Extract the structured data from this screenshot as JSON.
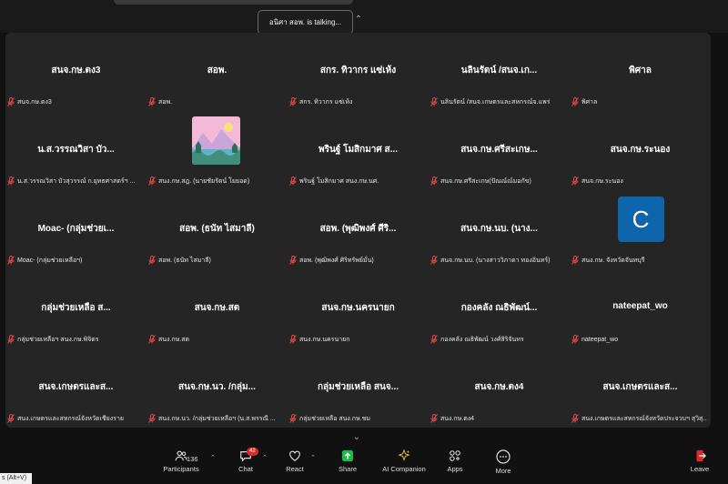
{
  "talking_indicator": "อนิศา สอพ. is talking...",
  "tiles": [
    {
      "big": "สนจ.กษ.ตง3",
      "name": "สนจ.กษ.ตง3"
    },
    {
      "big": "สอพ.",
      "name": "สอพ."
    },
    {
      "big": "สกร. ทิวากร แซ่เห้ง",
      "name": "สกร. ทิวากร แซ่เห้ง"
    },
    {
      "big": "นลินรัตน์ /สนจ.เก...",
      "name": "นลินรัตน์ /สนจ.เกษตรและสหกรณ์จ.แพร่"
    },
    {
      "big": "พิศาล",
      "name": "พิศาล"
    },
    {
      "big": "น.ส.วรรณวิสา บัว...",
      "name": "น.ส.วรรณวิสา บัวสุวรรณ์ ก.ยุทธศาสตร์ฯ ..."
    },
    {
      "big": "",
      "name": "สนง.กษ.สฎ. (นายชัยรัตน์ โยยอด)",
      "avatar": "landscape"
    },
    {
      "big": "พรินฐ์ โมสิกมาศ ส...",
      "name": "พรินฐ์ โมสิกมาศ สนง.กษ.นศ."
    },
    {
      "big": "สนจ.กษ.ศรีสะเกษ...",
      "name": "สนจ.กษ.ศรีสะเกษ(ปัณณ์ณ์มอกัข)"
    },
    {
      "big": "สนจ.กษ.ระนอง",
      "name": "สนจ.กษ.ระนอง"
    },
    {
      "big": "Moac- (กลุ่มช่วยเ...",
      "name": "Moac- (กลุ่มช่วยเหลือฯ)"
    },
    {
      "big": "สอพ. (ธนัท ไสมาลี)",
      "name": "สอพ. (ธนัท ไสมาลี)"
    },
    {
      "big": "สอพ. (พุฒิพงศ์ ศีริ...",
      "name": "สอพ. (พุฒิพงศ์ ศิริทรัพย์มั่น)"
    },
    {
      "big": "สนจ.กษ.นบ. (นาง...",
      "name": "สนจ.กษ.นบ. (นางสาววิภาดา ทองอินทร์)"
    },
    {
      "big": "",
      "name": "สนง.กษ. จังหวัดจันทบุรี",
      "avatar": "C"
    },
    {
      "big": "กลุ่มช่วยเหลือ ส...",
      "name": "กลุ่มช่วยเหลือฯ สนง.กษ.พิจิตร"
    },
    {
      "big": "สนจ.กษ.สต",
      "name": "สนง.กษ.สต"
    },
    {
      "big": "สนจ.กษ.นครนายก",
      "name": "สนง.กษ.นครนายก"
    },
    {
      "big": "กองคลัง ณธิพัฒน์...",
      "name": "กองคลัง ณธิพัฒน์ วงศ์สิริจันทร"
    },
    {
      "big": "nateepat_wo",
      "name": "nateepat_wo"
    },
    {
      "big": "สนจ.เกษตรและส...",
      "name": "สนง.เกษตรและสหกรณ์จังหวัดเชียงราย"
    },
    {
      "big": "สนจ.กษ.นว. /กลุ่ม...",
      "name": "สนง.กษ.นว. /กลุ่มช่วยเหลือฯ (น.ส.พรรณี ..."
    },
    {
      "big": "กลุ่มช่วยเหลือ สนจ...",
      "name": "กลุ่มช่วยเหลือ สนง.กษ.ชม"
    },
    {
      "big": "สนจ.กษ.ตง4",
      "name": "สนง.กษ.ตง4"
    },
    {
      "big": "สนจ.เกษตรและส...",
      "name": "สนง.เกษตรและสหกรณ์จังหวัดประจวบฯ สุวิสุ..."
    }
  ],
  "avatar_letter": "C",
  "toolbar": {
    "participants_label": "Participants",
    "participants_count": "136",
    "chat_label": "Chat",
    "chat_badge": "42",
    "react_label": "React",
    "share_label": "Share",
    "ai_label": "AI Companion",
    "apps_label": "Apps",
    "more_label": "More",
    "leave_label": "Leave"
  },
  "shortcut_hint": "s (Alt+V)",
  "colors": {
    "share": "#1fb84a",
    "leave": "#e02828",
    "ai": "#d9b642",
    "avatar_c": "#0f65ac"
  }
}
